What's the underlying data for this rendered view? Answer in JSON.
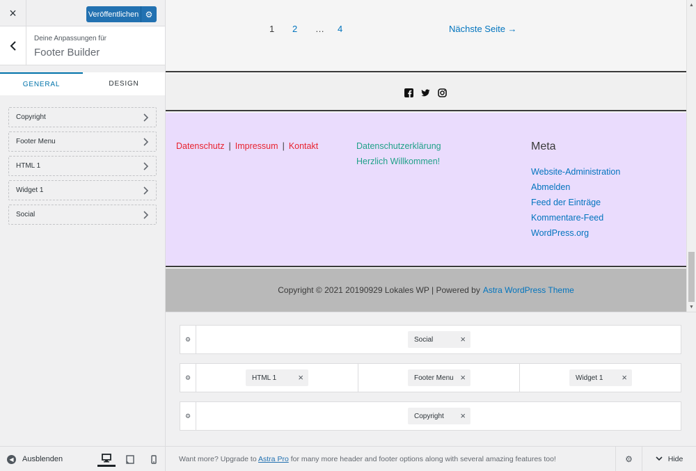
{
  "sidebar": {
    "close_icon": "×",
    "publish_label": "Veröffentlichen",
    "publish_gear_icon": "⚙",
    "back_icon": "‹",
    "title_sub": "Deine Anpassungen für",
    "title_main": "Footer Builder",
    "tabs": [
      {
        "label": "General",
        "active": true
      },
      {
        "label": "Design",
        "active": false
      }
    ],
    "items": [
      {
        "label": "Copyright"
      },
      {
        "label": "Footer Menu"
      },
      {
        "label": "HTML 1"
      },
      {
        "label": "Widget 1"
      },
      {
        "label": "Social"
      }
    ],
    "chevron_icon": "›",
    "hide_label": "Ausblenden",
    "hide_icon": "◀"
  },
  "preview": {
    "pagination": {
      "current": "1",
      "page2": "2",
      "ellipsis": "…",
      "page4": "4",
      "next": "Nächste Seite →"
    },
    "social_icons": [
      "facebook-icon",
      "twitter-icon",
      "instagram-icon"
    ],
    "footer_menu": [
      "Datenschutz",
      "Impressum",
      "Kontakt"
    ],
    "menu_separator": "|",
    "html_block": [
      "Datenschutzerklärung",
      "Herzlich Willkommen!"
    ],
    "meta": {
      "title": "Meta",
      "links": [
        "Website-Administration",
        "Abmelden",
        "Feed der Einträge",
        "Kommentare-Feed",
        "WordPress.org"
      ]
    },
    "copyright_text": "Copyright © 2021 20190929 Lokales WP | Powered by",
    "copyright_link": "Astra WordPress Theme",
    "colors": {
      "link": "#0274be",
      "menu_link": "#e8222f",
      "html_text": "#21a189",
      "widget_bg": "#eadcfd",
      "copyright_bg": "#b9b9b9"
    }
  },
  "builder": {
    "rows": [
      {
        "name": "above",
        "items": [
          {
            "label": "Social",
            "zone": "center"
          }
        ]
      },
      {
        "name": "primary",
        "items": [
          {
            "label": "HTML 1",
            "zone": "left"
          },
          {
            "label": "Footer Menu",
            "zone": "center"
          },
          {
            "label": "Widget 1",
            "zone": "right"
          }
        ]
      },
      {
        "name": "below",
        "items": [
          {
            "label": "Copyright",
            "zone": "center"
          }
        ]
      }
    ],
    "remove_icon": "×",
    "row_gear_icon": "⚙"
  },
  "bottom_bar": {
    "upgrade_prefix": "Want more? Upgrade to",
    "upgrade_link": "Astra Pro",
    "upgrade_suffix": "for many more header and footer options along with several amazing features too!",
    "gear_icon": "⚙",
    "hide_label": "Hide",
    "hide_chevron": "⌄"
  },
  "colors": {
    "accent": "#2271b1",
    "tab_active": "#0073aa"
  }
}
